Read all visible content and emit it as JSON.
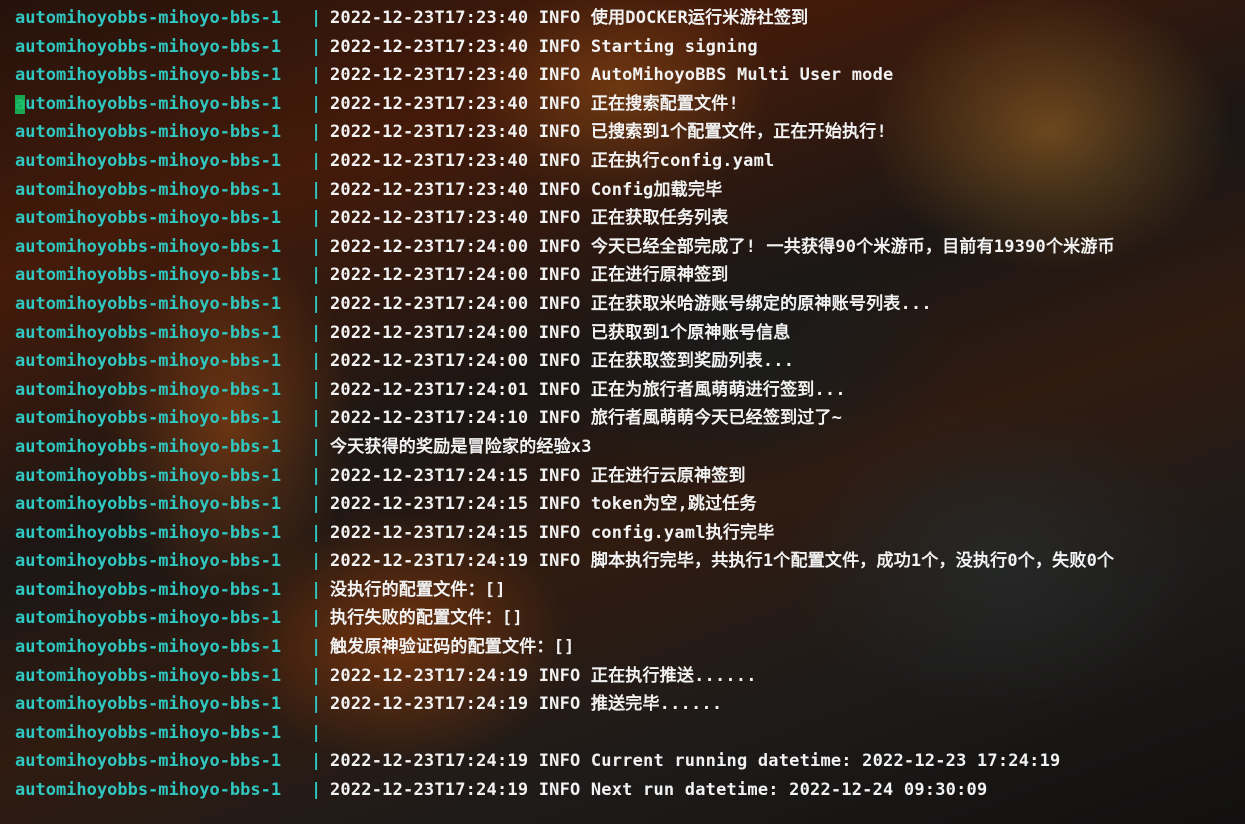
{
  "terminal": {
    "prefix_color": "#2fc7c0",
    "text_color": "#f2f2f2",
    "cursor_color": "#16c060",
    "cursor_line_index": 3,
    "lines": [
      {
        "container": "automihoyobbs-mihoyo-bbs-1",
        "sep": "|",
        "message": "2022-12-23T17:23:40 INFO 使用DOCKER运行米游社签到"
      },
      {
        "container": "automihoyobbs-mihoyo-bbs-1",
        "sep": "|",
        "message": "2022-12-23T17:23:40 INFO Starting signing"
      },
      {
        "container": "automihoyobbs-mihoyo-bbs-1",
        "sep": "|",
        "message": "2022-12-23T17:23:40 INFO AutoMihoyoBBS Multi User mode"
      },
      {
        "container": "automihoyobbs-mihoyo-bbs-1",
        "sep": "|",
        "message": "2022-12-23T17:23:40 INFO 正在搜索配置文件!"
      },
      {
        "container": "automihoyobbs-mihoyo-bbs-1",
        "sep": "|",
        "message": "2022-12-23T17:23:40 INFO 已搜索到1个配置文件，正在开始执行!"
      },
      {
        "container": "automihoyobbs-mihoyo-bbs-1",
        "sep": "|",
        "message": "2022-12-23T17:23:40 INFO 正在执行config.yaml"
      },
      {
        "container": "automihoyobbs-mihoyo-bbs-1",
        "sep": "|",
        "message": "2022-12-23T17:23:40 INFO Config加载完毕"
      },
      {
        "container": "automihoyobbs-mihoyo-bbs-1",
        "sep": "|",
        "message": "2022-12-23T17:23:40 INFO 正在获取任务列表"
      },
      {
        "container": "automihoyobbs-mihoyo-bbs-1",
        "sep": "|",
        "message": "2022-12-23T17:24:00 INFO 今天已经全部完成了! 一共获得90个米游币，目前有19390个米游币"
      },
      {
        "container": "automihoyobbs-mihoyo-bbs-1",
        "sep": "|",
        "message": "2022-12-23T17:24:00 INFO 正在进行原神签到"
      },
      {
        "container": "automihoyobbs-mihoyo-bbs-1",
        "sep": "|",
        "message": "2022-12-23T17:24:00 INFO 正在获取米哈游账号绑定的原神账号列表..."
      },
      {
        "container": "automihoyobbs-mihoyo-bbs-1",
        "sep": "|",
        "message": "2022-12-23T17:24:00 INFO 已获取到1个原神账号信息"
      },
      {
        "container": "automihoyobbs-mihoyo-bbs-1",
        "sep": "|",
        "message": "2022-12-23T17:24:00 INFO 正在获取签到奖励列表..."
      },
      {
        "container": "automihoyobbs-mihoyo-bbs-1",
        "sep": "|",
        "message": "2022-12-23T17:24:01 INFO 正在为旅行者風萌萌进行签到..."
      },
      {
        "container": "automihoyobbs-mihoyo-bbs-1",
        "sep": "|",
        "message": "2022-12-23T17:24:10 INFO 旅行者風萌萌今天已经签到过了~"
      },
      {
        "container": "automihoyobbs-mihoyo-bbs-1",
        "sep": "|",
        "message": "今天获得的奖励是冒险家的经验x3"
      },
      {
        "container": "automihoyobbs-mihoyo-bbs-1",
        "sep": "|",
        "message": "2022-12-23T17:24:15 INFO 正在进行云原神签到"
      },
      {
        "container": "automihoyobbs-mihoyo-bbs-1",
        "sep": "|",
        "message": "2022-12-23T17:24:15 INFO token为空,跳过任务"
      },
      {
        "container": "automihoyobbs-mihoyo-bbs-1",
        "sep": "|",
        "message": "2022-12-23T17:24:15 INFO config.yaml执行完毕"
      },
      {
        "container": "automihoyobbs-mihoyo-bbs-1",
        "sep": "|",
        "message": "2022-12-23T17:24:19 INFO 脚本执行完毕，共执行1个配置文件，成功1个，没执行0个，失败0个"
      },
      {
        "container": "automihoyobbs-mihoyo-bbs-1",
        "sep": "|",
        "message": "没执行的配置文件：[]"
      },
      {
        "container": "automihoyobbs-mihoyo-bbs-1",
        "sep": "|",
        "message": "执行失败的配置文件：[]"
      },
      {
        "container": "automihoyobbs-mihoyo-bbs-1",
        "sep": "|",
        "message": "触发原神验证码的配置文件：[]"
      },
      {
        "container": "automihoyobbs-mihoyo-bbs-1",
        "sep": "|",
        "message": "2022-12-23T17:24:19 INFO 正在执行推送......"
      },
      {
        "container": "automihoyobbs-mihoyo-bbs-1",
        "sep": "|",
        "message": "2022-12-23T17:24:19 INFO 推送完毕......"
      },
      {
        "container": "automihoyobbs-mihoyo-bbs-1",
        "sep": "|",
        "message": ""
      },
      {
        "container": "automihoyobbs-mihoyo-bbs-1",
        "sep": "|",
        "message": "2022-12-23T17:24:19 INFO Current running datetime: 2022-12-23 17:24:19"
      },
      {
        "container": "automihoyobbs-mihoyo-bbs-1",
        "sep": "|",
        "message": "2022-12-23T17:24:19 INFO Next run datetime: 2022-12-24 09:30:09"
      }
    ]
  }
}
